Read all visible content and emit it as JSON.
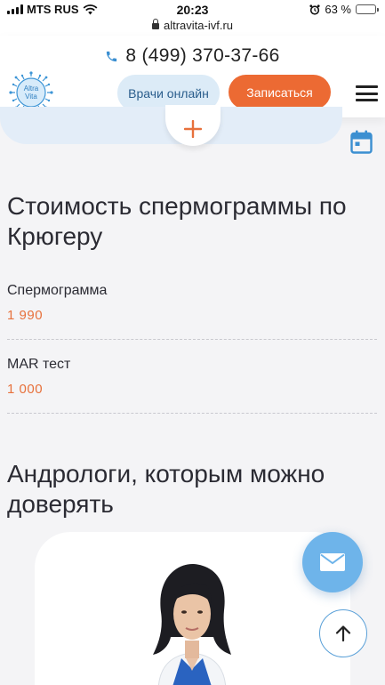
{
  "status_bar": {
    "carrier": "MTS RUS",
    "time": "20:23",
    "url": "altravita-ivf.ru",
    "battery": "63 %",
    "battery_level": 0.63
  },
  "header": {
    "phone": "8 (499) 370-37-66",
    "logo_text_top": "Altra",
    "logo_text_bottom": "Vita",
    "btn_doctors": "Врачи онлайн",
    "btn_signup": "Записаться"
  },
  "prices": {
    "title": "Стоимость спермограммы по Крюгеру",
    "items": [
      {
        "name": "Спермограмма",
        "price": "1 990"
      },
      {
        "name": "MAR тест",
        "price": "1 000"
      }
    ]
  },
  "doctors": {
    "title": "Андрологи, которым можно доверять"
  },
  "colors": {
    "accent_orange": "#ec6a33",
    "accent_blue": "#6eb4ea",
    "light_blue": "#dcebf7"
  },
  "icons": [
    "phone-icon",
    "plus-icon",
    "calendar-icon",
    "mail-icon",
    "arrow-up-icon",
    "menu-icon",
    "lock-icon",
    "wifi-icon",
    "alarm-icon"
  ]
}
